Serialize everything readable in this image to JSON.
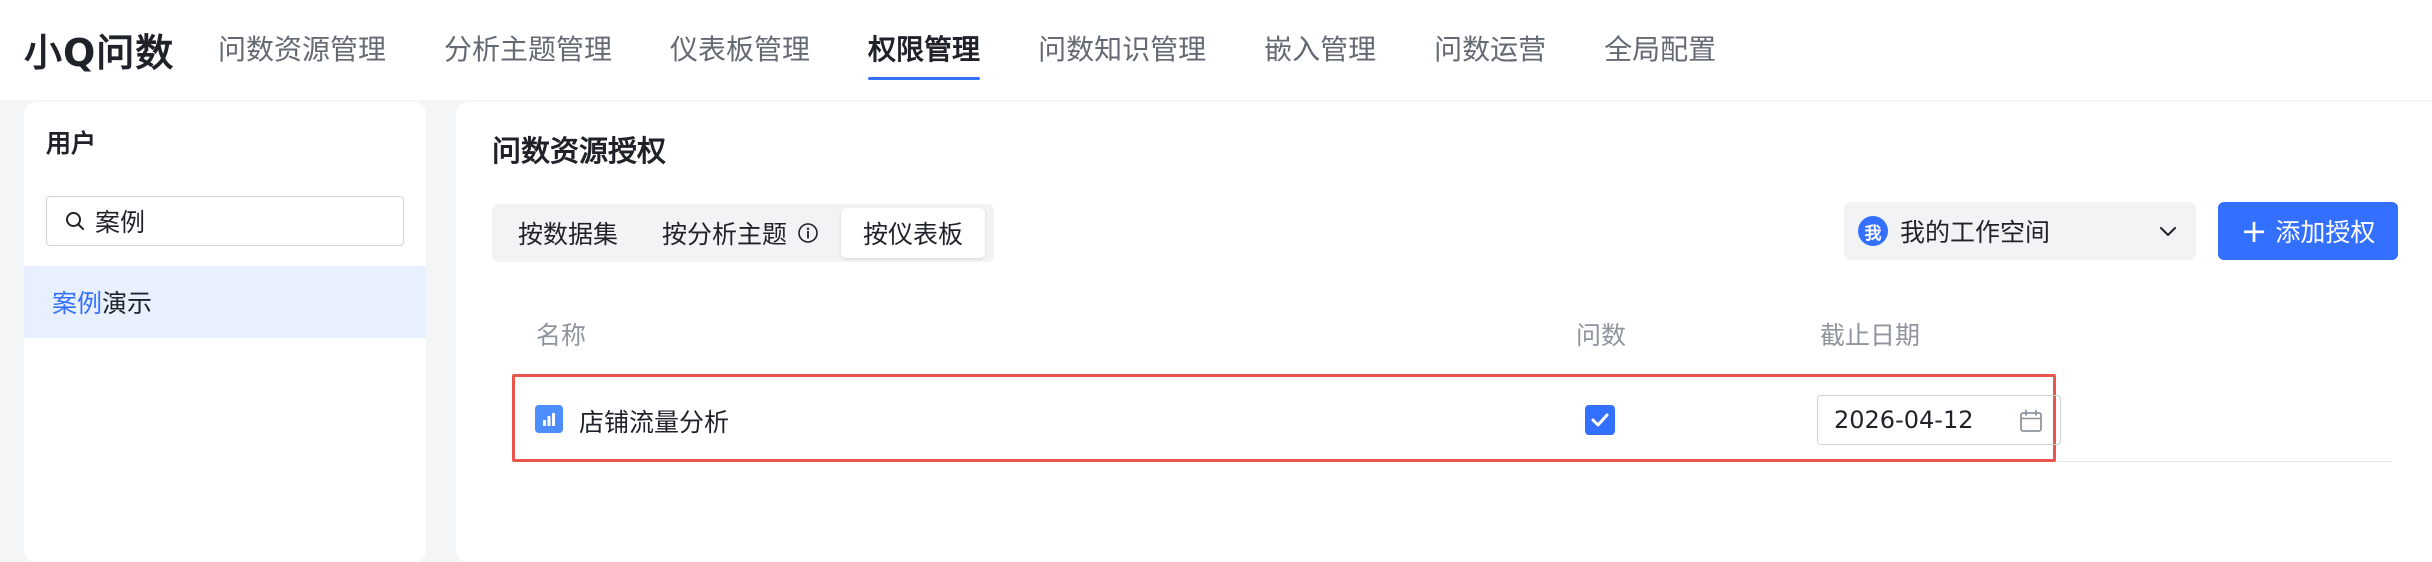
{
  "app": {
    "brand": "小Q问数"
  },
  "nav": {
    "items": [
      {
        "label": "问数资源管理"
      },
      {
        "label": "分析主题管理"
      },
      {
        "label": "仪表板管理"
      },
      {
        "label": "权限管理",
        "active": true
      },
      {
        "label": "问数知识管理"
      },
      {
        "label": "嵌入管理"
      },
      {
        "label": "问数运营"
      },
      {
        "label": "全局配置"
      }
    ]
  },
  "left": {
    "title": "用户",
    "search": {
      "value": "案例",
      "icon": "search-icon"
    },
    "users": [
      {
        "highlight": "案例",
        "rest": "演示",
        "selected": true
      }
    ]
  },
  "main": {
    "title": "问数资源授权",
    "tabs": [
      {
        "label": "按数据集"
      },
      {
        "label": "按分析主题",
        "icon": "info-icon"
      },
      {
        "label": "按仪表板",
        "active": true
      }
    ],
    "workspace": {
      "avatar": "我",
      "label": "我的工作空间"
    },
    "add_button": "添加授权",
    "table": {
      "columns": {
        "name": "名称",
        "ask": "问数",
        "deadline": "截止日期"
      },
      "rows": [
        {
          "name": "店铺流量分析",
          "ask_checked": true,
          "deadline": "2026-04-12",
          "icon": "dashboard-icon"
        }
      ]
    }
  },
  "colors": {
    "accent": "#3370ff",
    "highlight_border": "#e8554a",
    "selected_bg": "#e8f0fe"
  }
}
